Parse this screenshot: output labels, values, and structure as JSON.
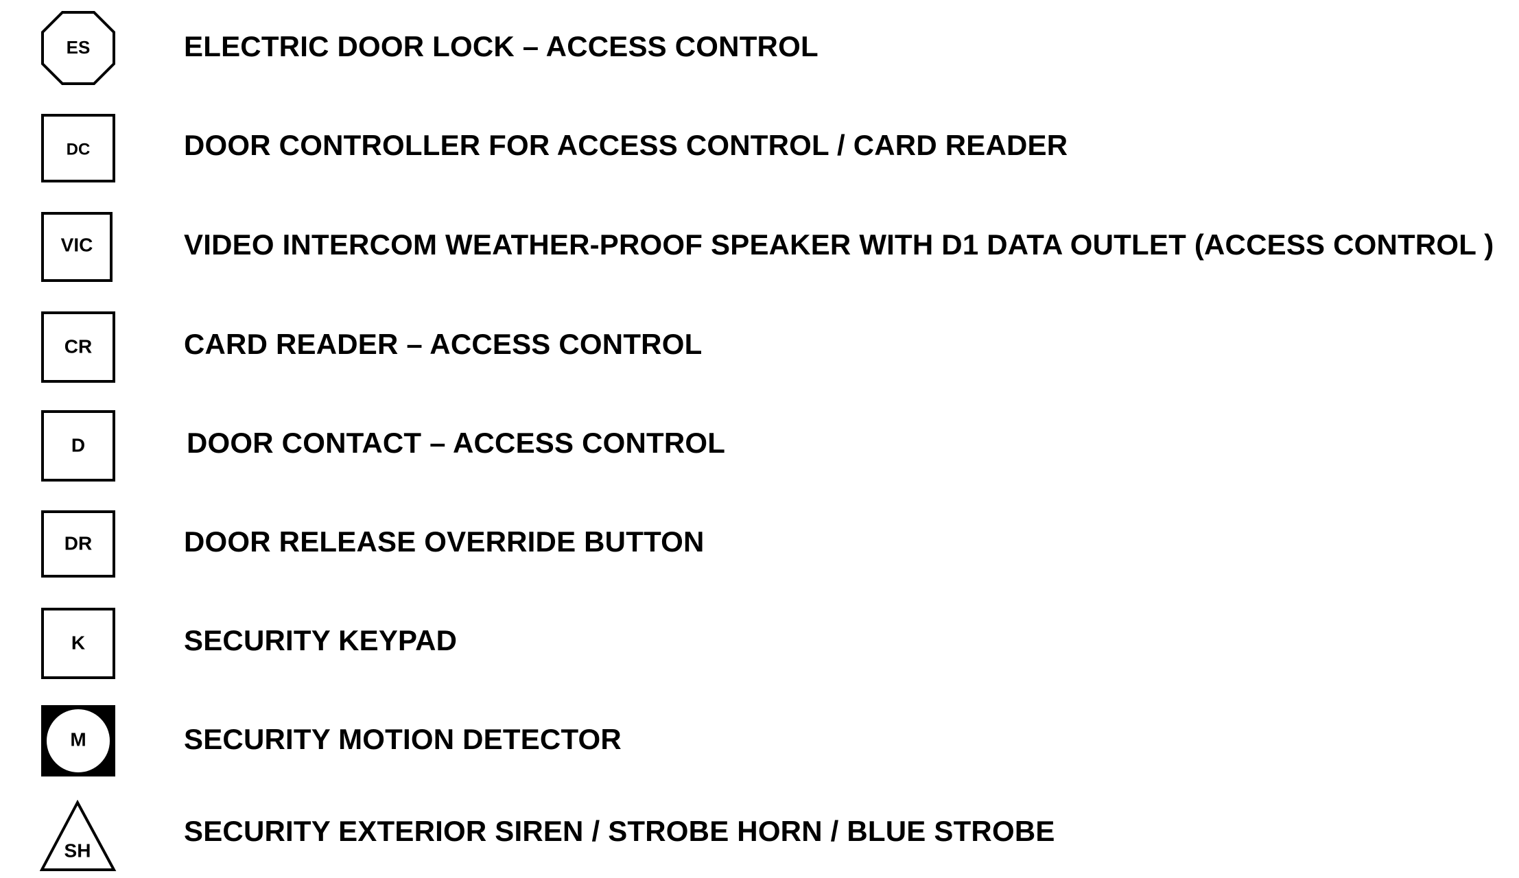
{
  "legend": {
    "items": [
      {
        "symbol": "ES",
        "symbol_shape": "octagon",
        "label": "ELECTRIC DOOR LOCK – ACCESS CONTROL"
      },
      {
        "symbol": "DC",
        "symbol_shape": "square",
        "label": "DOOR CONTROLLER  FOR ACCESS CONTROL / CARD READER"
      },
      {
        "symbol": "VIC",
        "symbol_shape": "square",
        "label": "VIDEO INTERCOM WEATHER-PROOF SPEAKER WITH D1 DATA OUTLET (ACCESS CONTROL )"
      },
      {
        "symbol": "CR",
        "symbol_shape": "square",
        "label": "CARD READER – ACCESS CONTROL"
      },
      {
        "symbol": "D",
        "symbol_shape": "square",
        "label": "DOOR CONTACT – ACCESS CONTROL"
      },
      {
        "symbol": "DR",
        "symbol_shape": "square",
        "label": "DOOR RELEASE OVERRIDE BUTTON"
      },
      {
        "symbol": "K",
        "symbol_shape": "square",
        "label": "SECURITY KEYPAD"
      },
      {
        "symbol": "M",
        "symbol_shape": "filled-square-with-circle",
        "label": "SECURITY MOTION DETECTOR"
      },
      {
        "symbol": "SH",
        "symbol_shape": "triangle",
        "label": "SECURITY EXTERIOR SIREN / STROBE HORN / BLUE STROBE"
      }
    ]
  },
  "colors": {
    "ink": "#000000",
    "background": "#ffffff"
  }
}
